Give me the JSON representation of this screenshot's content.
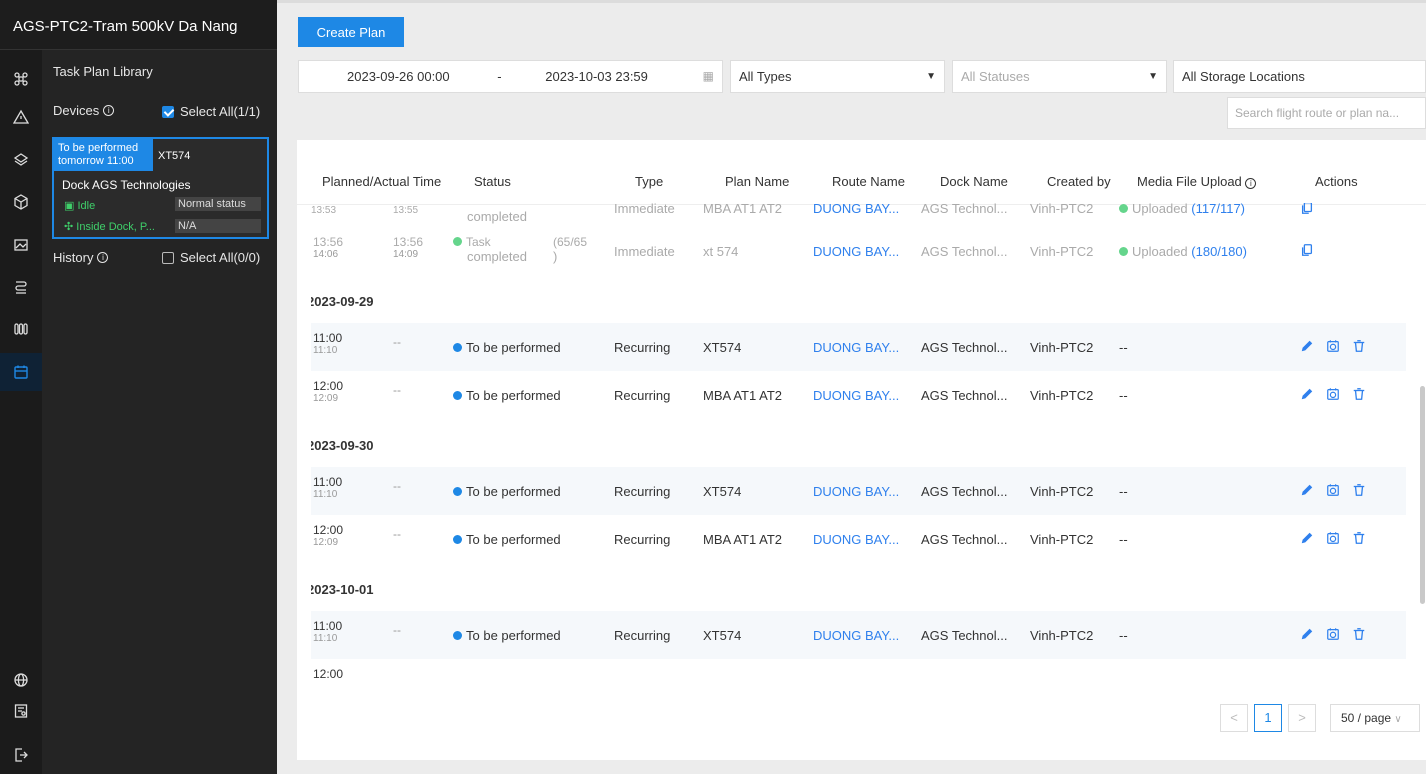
{
  "header": {
    "title": "AGS-PTC2-Tram 500kV Da Nang"
  },
  "rail": {
    "icons": [
      "drone-icon",
      "warning-triangle-icon",
      "layers-icon",
      "cube-icon",
      "media-icon",
      "route-icon",
      "dock-icon",
      "calendar-icon",
      "globe-icon",
      "report-icon",
      "logout-icon"
    ],
    "active": "calendar-icon"
  },
  "panel": {
    "title": "Task Plan Library",
    "devices_label": "Devices",
    "select_all_devices": "Select All(1/1)",
    "device_card": {
      "badge_line1": "To be performed",
      "badge_line2": "tomorrow 11:00",
      "device_name": "XT574",
      "dock_name": "Dock AGS Technologies",
      "state1": "Idle",
      "value1": "Normal status",
      "state2": "Inside Dock, P...",
      "value2": "N/A"
    },
    "history_label": "History",
    "select_all_history": "Select All(0/0)"
  },
  "toolbar": {
    "create_label": "Create Plan",
    "date_start": "2023-09-26 00:00",
    "date_sep": "-",
    "date_end": "2023-10-03 23:59",
    "type_filter": "All Types",
    "status_filter": "All Statuses",
    "storage_filter": "All Storage Locations",
    "search_placeholder": "Search flight route or plan na..."
  },
  "table": {
    "headers": [
      "Planned/Actual Time",
      "Status",
      "Type",
      "Plan Name",
      "Route Name",
      "Dock Name",
      "Created by",
      "Media File Upload",
      "Actions"
    ],
    "completed_rows": [
      {
        "p_start": "13:53",
        "a_start": "13:55",
        "status": "completed",
        "type": "Immediate",
        "plan": "MBA AT1 AT2",
        "route": "DUONG BAY...",
        "dock": "AGS Technol...",
        "creator": "Vinh-PTC2",
        "media_prefix": "Uploaded",
        "media_count": "(117/117)"
      },
      {
        "p_start": "13:56",
        "p_end": "14:06",
        "a_start": "13:56",
        "a_end": "14:09",
        "status_line1": "Task",
        "status_line2": "completed",
        "status_count": "(65/65",
        "status_close": ")",
        "type": "Immediate",
        "plan": "xt 574",
        "route": "DUONG BAY...",
        "dock": "AGS Technol...",
        "creator": "Vinh-PTC2",
        "media_prefix": "Uploaded",
        "media_count": "(180/180)"
      }
    ],
    "groups": [
      {
        "date": "2023-09-29",
        "rows": [
          {
            "start": "11:00",
            "end": "11:10",
            "actual": "--",
            "status": "To be performed",
            "type": "Recurring",
            "plan": "XT574",
            "route": "DUONG BAY...",
            "dock": "AGS Technol...",
            "creator": "Vinh-PTC2",
            "media": "--"
          },
          {
            "start": "12:00",
            "end": "12:09",
            "actual": "--",
            "status": "To be performed",
            "type": "Recurring",
            "plan": "MBA AT1 AT2",
            "route": "DUONG BAY...",
            "dock": "AGS Technol...",
            "creator": "Vinh-PTC2",
            "media": "--"
          }
        ]
      },
      {
        "date": "2023-09-30",
        "rows": [
          {
            "start": "11:00",
            "end": "11:10",
            "actual": "--",
            "status": "To be performed",
            "type": "Recurring",
            "plan": "XT574",
            "route": "DUONG BAY...",
            "dock": "AGS Technol...",
            "creator": "Vinh-PTC2",
            "media": "--"
          },
          {
            "start": "12:00",
            "end": "12:09",
            "actual": "--",
            "status": "To be performed",
            "type": "Recurring",
            "plan": "MBA AT1 AT2",
            "route": "DUONG BAY...",
            "dock": "AGS Technol...",
            "creator": "Vinh-PTC2",
            "media": "--"
          }
        ]
      },
      {
        "date": "2023-10-01",
        "rows": [
          {
            "start": "11:00",
            "end": "11:10",
            "actual": "--",
            "status": "To be performed",
            "type": "Recurring",
            "plan": "XT574",
            "route": "DUONG BAY...",
            "dock": "AGS Technol...",
            "creator": "Vinh-PTC2",
            "media": "--"
          },
          {
            "start": "12:00"
          }
        ]
      }
    ]
  },
  "pagination": {
    "prev": "<",
    "page": "1",
    "next": ">",
    "page_size": "50 / page"
  },
  "colors": {
    "accent": "#1e88e5",
    "link": "#2f80ed",
    "success": "#65d58c",
    "sidebar": "#242424"
  }
}
